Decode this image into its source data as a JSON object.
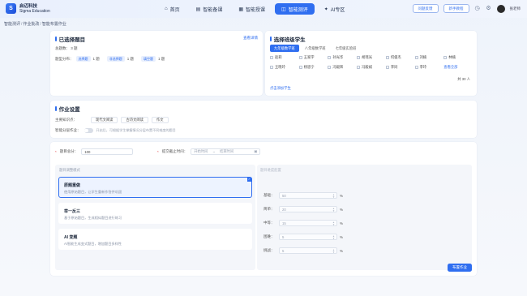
{
  "brand": {
    "name_cn": "启迈科技",
    "name_en": "Sigma Education",
    "logo_char": "S"
  },
  "nav": [
    {
      "label": "首页",
      "icon": "⌂"
    },
    {
      "label": "智能备课",
      "icon": "▤"
    },
    {
      "label": "智能授课",
      "icon": "▦"
    },
    {
      "label": "智能测评",
      "icon": "◫"
    },
    {
      "label": "AI专区",
      "icon": "✦"
    }
  ],
  "top_right": {
    "btn_guide": "问题反馈",
    "btn_tutorial": "新手教程",
    "username": "张老师"
  },
  "breadcrumb": [
    "智能测评",
    "作业批改",
    "智能布置作业"
  ],
  "questions": {
    "title": "已选择题目",
    "view_detail": "查看详情",
    "total_label": "总题数：",
    "total_value": "3 题",
    "dist_label": "题型分布：",
    "dist": [
      {
        "type": "选择题",
        "count": "1 题"
      },
      {
        "type": "非选择题",
        "count": "1 题"
      },
      {
        "type": "填空题",
        "count": "1 题"
      }
    ]
  },
  "students": {
    "title": "选择班级学生",
    "tabs": [
      "九年级数学班",
      "八年级数学班",
      "七年级实验班"
    ],
    "list": [
      "赵莉",
      "王家宇",
      "孙光华",
      "胡瑶光",
      "何俊杰",
      "刘楠",
      "林楠",
      "王晓玲",
      "杨思宁",
      "冯毅辉",
      "冯毅斌",
      "李同",
      "李玲"
    ],
    "select_all": "查看全部",
    "add": "点击添加学生",
    "count": "共 30 人"
  },
  "settings": {
    "title": "作业设置",
    "kp_label": "主要知识点：",
    "kp_chips": [
      "现代文阅读",
      "古诗文阅读",
      "作文"
    ],
    "layer_label": "智能分层作业：",
    "layer_hint": "开启后，可根据学生掌握情况分层布置不同难度的题目"
  },
  "bottom": {
    "score_label": "题目总分：",
    "score_value": "100",
    "deadline_label": "提交截止时间：",
    "deadline_start": "开始时间",
    "deadline_sep": "~",
    "deadline_end": "结束时间",
    "mode_title": "题目调整模式",
    "modes": [
      {
        "name": "原题重做",
        "desc": "使用原始题目，让学生重新作答并巩固"
      },
      {
        "name": "举一反三",
        "desc": "基于原始题目，生成相似题目进行练习"
      },
      {
        "name": "AI 变题",
        "desc": "AI智能生成变式题目，增加题目多样性"
      }
    ],
    "diff_title": "题目难度配置",
    "diff": [
      {
        "label": "基础：",
        "value": "50"
      },
      {
        "label": "简单：",
        "value": "20"
      },
      {
        "label": "中等：",
        "value": "15"
      },
      {
        "label": "困难：",
        "value": "5"
      },
      {
        "label": "挑战：",
        "value": "5"
      }
    ],
    "pct": "%",
    "confirm": "布置作业"
  },
  "colors": {
    "accent": "#2f6ef0",
    "required": "#e5484d"
  }
}
